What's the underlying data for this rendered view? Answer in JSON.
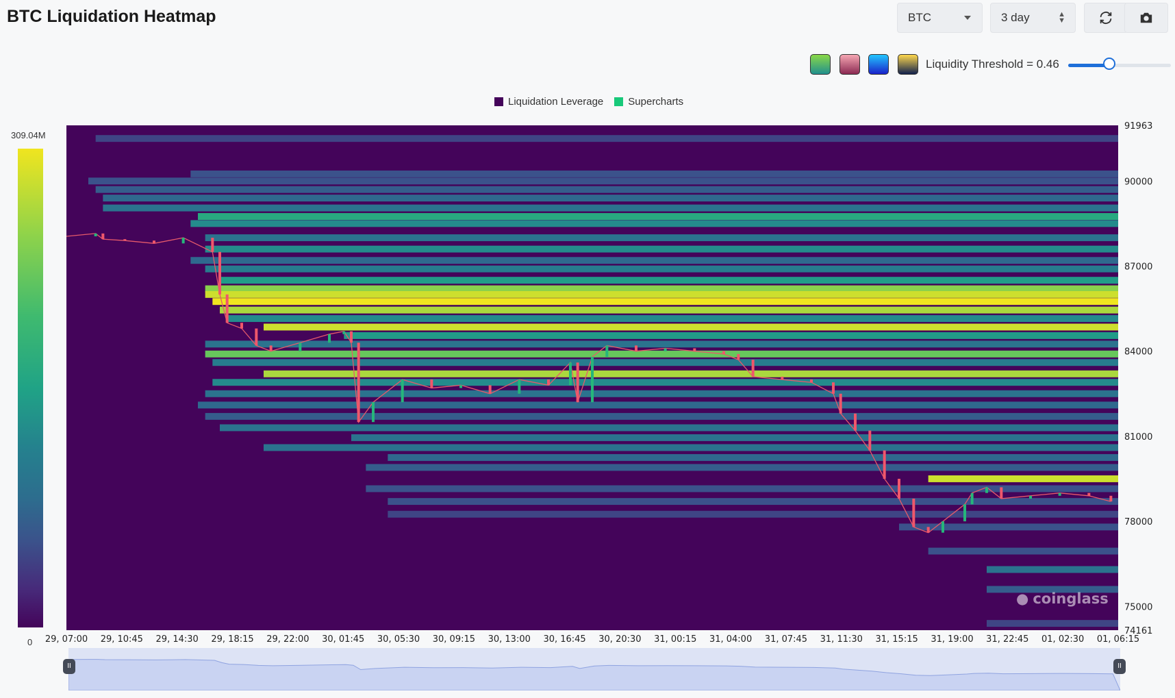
{
  "header": {
    "title": "BTC Liquidation Heatmap",
    "coin_select": "BTC",
    "range_select": "3 day"
  },
  "icons": {
    "refresh": "refresh-icon",
    "camera": "camera-icon",
    "dropdown": "chevron-down-icon",
    "stepper": "up-down-icon"
  },
  "palettes": [
    {
      "name": "viridis",
      "top": "#8ad848",
      "bottom": "#21908d"
    },
    {
      "name": "rose",
      "top": "#f6a7b3",
      "bottom": "#8b2a52"
    },
    {
      "name": "blue",
      "top": "#23c6ff",
      "bottom": "#1a21c9"
    },
    {
      "name": "dusk",
      "top": "#ffd84d",
      "bottom": "#12214d"
    }
  ],
  "threshold": {
    "label": "Liquidity Threshold = 0.46",
    "value": 0.46
  },
  "legend": [
    {
      "label": "Liquidation Leverage",
      "color": "#44045a"
    },
    {
      "label": "Supercharts",
      "color": "#18c97a"
    }
  ],
  "colorbar": {
    "max_label": "309.04M",
    "min_label": "0"
  },
  "watermark": "coinglass",
  "chart_data": {
    "type": "heatmap",
    "title": "BTC Liquidation Heatmap",
    "y_ticks": [
      "91963",
      "90000",
      "87000",
      "84000",
      "81000",
      "78000",
      "75000",
      "74161"
    ],
    "ylim": [
      74161,
      91963
    ],
    "x_ticks": [
      "29, 07:00",
      "29, 10:45",
      "29, 14:30",
      "29, 18:15",
      "29, 22:00",
      "30, 01:45",
      "30, 05:30",
      "30, 09:15",
      "30, 13:00",
      "30, 16:45",
      "30, 20:30",
      "31, 00:15",
      "31, 04:00",
      "31, 07:45",
      "31, 11:30",
      "31, 15:15",
      "31, 19:00",
      "31, 22:45",
      "01, 02:30",
      "01, 06:15"
    ],
    "x_range_hours": [
      0,
      72
    ],
    "colorscale_max": 309040000,
    "colorscale_min": 0,
    "price_series": [
      [
        0,
        88050
      ],
      [
        2,
        88150
      ],
      [
        2.5,
        87950
      ],
      [
        4,
        87900
      ],
      [
        6,
        87800
      ],
      [
        8,
        88000
      ],
      [
        10,
        87500
      ],
      [
        10.5,
        86000
      ],
      [
        11,
        85000
      ],
      [
        12,
        84800
      ],
      [
        13,
        84200
      ],
      [
        14,
        84000
      ],
      [
        16,
        84300
      ],
      [
        18,
        84600
      ],
      [
        19,
        84700
      ],
      [
        19.5,
        84300
      ],
      [
        20,
        81500
      ],
      [
        21,
        82200
      ],
      [
        23,
        83000
      ],
      [
        25,
        82700
      ],
      [
        27,
        82800
      ],
      [
        29,
        82500
      ],
      [
        31,
        83000
      ],
      [
        33,
        82800
      ],
      [
        34.5,
        83600
      ],
      [
        35,
        82200
      ],
      [
        36,
        83800
      ],
      [
        37,
        84200
      ],
      [
        39,
        84000
      ],
      [
        41,
        84100
      ],
      [
        43,
        84000
      ],
      [
        45,
        83900
      ],
      [
        46,
        83700
      ],
      [
        47,
        83100
      ],
      [
        49,
        83000
      ],
      [
        51,
        82900
      ],
      [
        52.5,
        82500
      ],
      [
        53,
        81800
      ],
      [
        54,
        81200
      ],
      [
        55,
        80500
      ],
      [
        56,
        79500
      ],
      [
        57,
        78800
      ],
      [
        58,
        77800
      ],
      [
        59,
        77600
      ],
      [
        60,
        78000
      ],
      [
        61.5,
        78600
      ],
      [
        62,
        79000
      ],
      [
        63,
        79200
      ],
      [
        64,
        78800
      ],
      [
        66,
        78900
      ],
      [
        68,
        79000
      ],
      [
        70,
        78900
      ],
      [
        71.5,
        78700
      ]
    ],
    "liquidity_bands": [
      {
        "y": 91500,
        "start_h": 2,
        "level": 0.25
      },
      {
        "y": 90250,
        "start_h": 8.5,
        "level": 0.3
      },
      {
        "y": 90000,
        "start_h": 1.5,
        "level": 0.3
      },
      {
        "y": 89700,
        "start_h": 2,
        "level": 0.35
      },
      {
        "y": 89400,
        "start_h": 2.5,
        "level": 0.4
      },
      {
        "y": 89050,
        "start_h": 2.5,
        "level": 0.45
      },
      {
        "y": 88750,
        "start_h": 9,
        "level": 0.65
      },
      {
        "y": 88500,
        "start_h": 8.5,
        "level": 0.55
      },
      {
        "y": 88000,
        "start_h": 9.5,
        "level": 0.45
      },
      {
        "y": 87600,
        "start_h": 9.5,
        "level": 0.55
      },
      {
        "y": 87200,
        "start_h": 8.5,
        "level": 0.4
      },
      {
        "y": 86900,
        "start_h": 9.5,
        "level": 0.5
      },
      {
        "y": 86500,
        "start_h": 10.5,
        "level": 0.6
      },
      {
        "y": 86200,
        "start_h": 9.5,
        "level": 0.85
      },
      {
        "y": 86000,
        "start_h": 9.5,
        "level": 0.95
      },
      {
        "y": 85750,
        "start_h": 10,
        "level": 1.0
      },
      {
        "y": 85450,
        "start_h": 10.5,
        "level": 0.9
      },
      {
        "y": 85150,
        "start_h": 11,
        "level": 0.55
      },
      {
        "y": 84850,
        "start_h": 13.5,
        "level": 0.95
      },
      {
        "y": 84550,
        "start_h": 19,
        "level": 0.6
      },
      {
        "y": 84250,
        "start_h": 9.5,
        "level": 0.45
      },
      {
        "y": 83900,
        "start_h": 9.5,
        "level": 0.8
      },
      {
        "y": 83600,
        "start_h": 10,
        "level": 0.5
      },
      {
        "y": 83200,
        "start_h": 13.5,
        "level": 0.9
      },
      {
        "y": 82900,
        "start_h": 10,
        "level": 0.55
      },
      {
        "y": 82500,
        "start_h": 9.5,
        "level": 0.45
      },
      {
        "y": 82100,
        "start_h": 9,
        "level": 0.4
      },
      {
        "y": 81700,
        "start_h": 9.5,
        "level": 0.35
      },
      {
        "y": 81300,
        "start_h": 10.5,
        "level": 0.45
      },
      {
        "y": 80950,
        "start_h": 19.5,
        "level": 0.45
      },
      {
        "y": 80600,
        "start_h": 13.5,
        "level": 0.45
      },
      {
        "y": 80250,
        "start_h": 22,
        "level": 0.4
      },
      {
        "y": 79900,
        "start_h": 20.5,
        "level": 0.35
      },
      {
        "y": 79500,
        "start_h": 59,
        "level": 0.95
      },
      {
        "y": 79150,
        "start_h": 20.5,
        "level": 0.3
      },
      {
        "y": 78700,
        "start_h": 22,
        "level": 0.3
      },
      {
        "y": 78250,
        "start_h": 22,
        "level": 0.25
      },
      {
        "y": 77800,
        "start_h": 57,
        "level": 0.3
      },
      {
        "y": 76950,
        "start_h": 59,
        "level": 0.3
      },
      {
        "y": 76300,
        "start_h": 63,
        "level": 0.45
      },
      {
        "y": 75600,
        "start_h": 63,
        "level": 0.35
      },
      {
        "y": 74400,
        "start_h": 63,
        "level": 0.25
      }
    ]
  }
}
